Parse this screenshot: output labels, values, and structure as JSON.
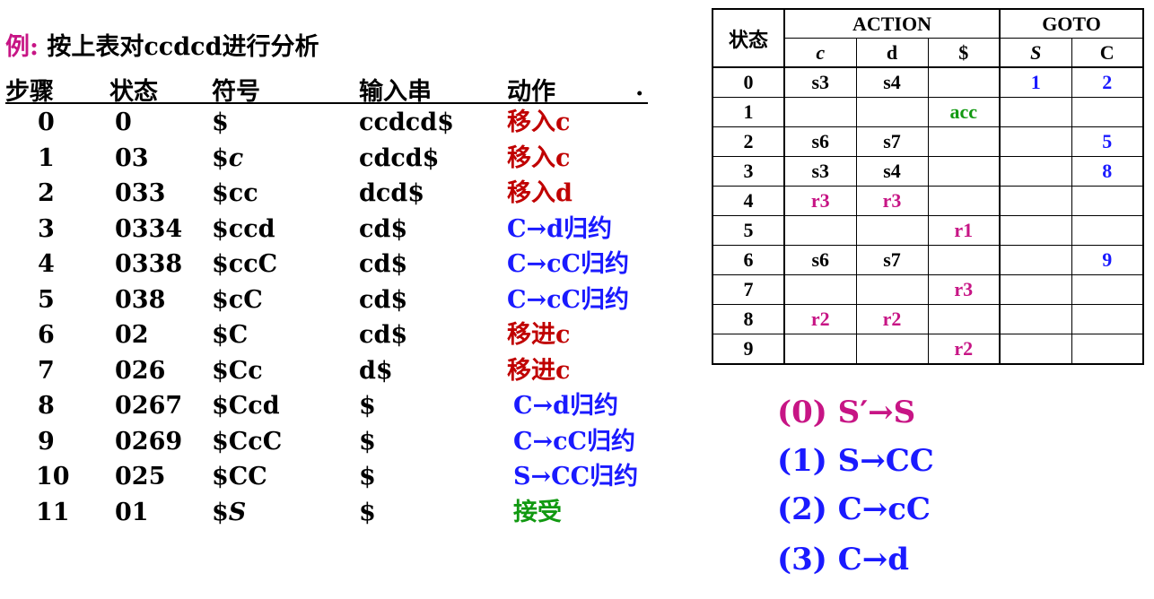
{
  "title": {
    "prefix": "例:",
    "text": " 按上表对ccdcd进行分析"
  },
  "trace_headers": [
    "步骤",
    "状态",
    "符号",
    "输入串",
    "动作"
  ],
  "header_dot": ".",
  "rows": [
    {
      "step": "0",
      "state": "0",
      "symbol": "$",
      "input": "ccdcd$",
      "action": "移入c",
      "action_color": "#c00000"
    },
    {
      "step": "1",
      "state": "03",
      "symbol": "$c",
      "input": "cdcd$",
      "action": "移入c",
      "action_color": "#c00000"
    },
    {
      "step": "2",
      "state": "033",
      "symbol": "$cc",
      "input": "dcd$",
      "action": "移入d",
      "action_color": "#c00000"
    },
    {
      "step": "3",
      "state": "0334",
      "symbol": "$ccd",
      "input": "cd$",
      "action": "C→d归约",
      "action_color": "#1a1aff"
    },
    {
      "step": "4",
      "state": "0338",
      "symbol": "$ccC",
      "input": "cd$",
      "action": "C→cC归约",
      "action_color": "#1a1aff"
    },
    {
      "step": "5",
      "state": "038",
      "symbol": "$cC",
      "input": "cd$",
      "action": "C→cC归约",
      "action_color": "#1a1aff"
    },
    {
      "step": "6",
      "state": "02",
      "symbol": "$C",
      "input": "cd$",
      "action": "移进c",
      "action_color": "#c00000"
    },
    {
      "step": "7",
      "state": "026",
      "symbol": "$Cc",
      "input": "d$",
      "action": "移进c",
      "action_color": "#c00000"
    },
    {
      "step": "8",
      "state": "0267",
      "symbol": "$Ccd",
      "input": "$",
      "action": "C→d归约",
      "action_color": "#1a1aff"
    },
    {
      "step": "9",
      "state": "0269",
      "symbol": "$CcC",
      "input": "$",
      "action": "C→cC归约",
      "action_color": "#1a1aff"
    },
    {
      "step": "10",
      "state": "025",
      "symbol": "$CC",
      "input": "$",
      "action": "S→CC归约",
      "action_color": "#1a1aff"
    },
    {
      "step": "11",
      "state": "01",
      "symbol": "$S",
      "input": "$",
      "action": "接受",
      "action_color": "#119911"
    }
  ],
  "parse_table": {
    "state_header": "状态",
    "action_header": "ACTION",
    "goto_header": "GOTO",
    "columns": [
      "c",
      "d",
      "$",
      "S",
      "C"
    ],
    "rows": [
      {
        "state": "0",
        "cells": [
          "s3",
          "s4",
          "",
          "1",
          "2"
        ]
      },
      {
        "state": "1",
        "cells": [
          "",
          "",
          "acc",
          "",
          ""
        ]
      },
      {
        "state": "2",
        "cells": [
          "s6",
          "s7",
          "",
          "",
          "5"
        ]
      },
      {
        "state": "3",
        "cells": [
          "s3",
          "s4",
          "",
          "",
          "8"
        ]
      },
      {
        "state": "4",
        "cells": [
          "r3",
          "r3",
          "",
          "",
          ""
        ]
      },
      {
        "state": "5",
        "cells": [
          "",
          "",
          "r1",
          "",
          ""
        ]
      },
      {
        "state": "6",
        "cells": [
          "s6",
          "s7",
          "",
          "",
          "9"
        ]
      },
      {
        "state": "7",
        "cells": [
          "",
          "",
          "r3",
          "",
          ""
        ]
      },
      {
        "state": "8",
        "cells": [
          "r2",
          "r2",
          "",
          "",
          ""
        ]
      },
      {
        "state": "9",
        "cells": [
          "",
          "",
          "r2",
          "",
          ""
        ]
      }
    ],
    "colors": {
      "shift": "#000000",
      "reduce": "#c71585",
      "accept": "#119911",
      "goto": "#1a1aff"
    }
  },
  "grammar": [
    {
      "text": "(0) S′→S",
      "color": "#c71585"
    },
    {
      "text": "(1) S→CC",
      "color": "#1a1aff"
    },
    {
      "text": "(2) C→cC",
      "color": "#1a1aff"
    },
    {
      "text": "(3) C→d",
      "color": "#1a1aff"
    }
  ]
}
